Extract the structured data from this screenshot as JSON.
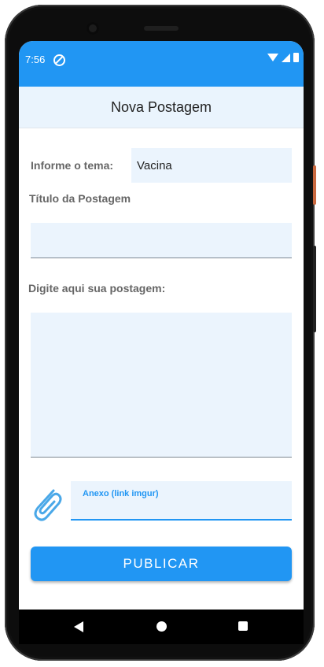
{
  "status_bar": {
    "time": "7:56",
    "icons": [
      "dnd-icon",
      "wifi-icon",
      "signal-icon",
      "battery-icon"
    ]
  },
  "app_bar": {
    "title": "Nova Postagem"
  },
  "form": {
    "topic_label": "Informe o tema:",
    "topic_value": "Vacina",
    "title_label": "Título da Postagem",
    "title_value": "",
    "body_label": "Digite aqui sua postagem:",
    "body_value": "",
    "attachment_icon": "paperclip-icon",
    "attachment_label": "Anexo (link imgur)",
    "attachment_value": "",
    "publish_label": "PUBLICAR"
  },
  "nav_bar": {
    "icons": [
      "back-icon",
      "home-icon",
      "recents-icon"
    ]
  },
  "colors": {
    "primary": "#2196f3",
    "app_bar_bg": "#eaf4fd",
    "field_bg": "#ebf4fd",
    "label_text": "#666666"
  }
}
